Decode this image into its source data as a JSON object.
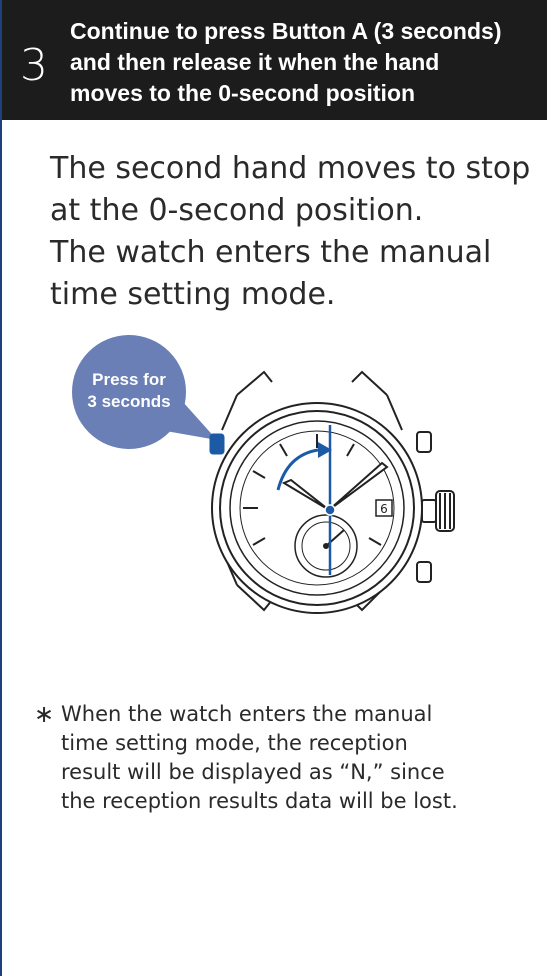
{
  "step": {
    "number": "3",
    "title_lines": [
      "Continue to press Button A (3 seconds)",
      "and then release it when the hand",
      "moves to the 0-second position"
    ]
  },
  "body_lines": [
    "The second hand moves to stop",
    "at the 0-second position.",
    "The watch enters the manual",
    "time setting mode."
  ],
  "illustration": {
    "callout_lines": [
      "Press for",
      "3 seconds"
    ],
    "date_window": "6",
    "colors": {
      "accent": "#1d5aa6",
      "callout": "#6a7fb5",
      "outline": "#222222"
    }
  },
  "note": {
    "mark": "∗",
    "lines": [
      "When the watch enters the manual",
      "time setting mode, the reception",
      "result will be displayed as “N,” since",
      "the reception results data will be lost."
    ]
  }
}
